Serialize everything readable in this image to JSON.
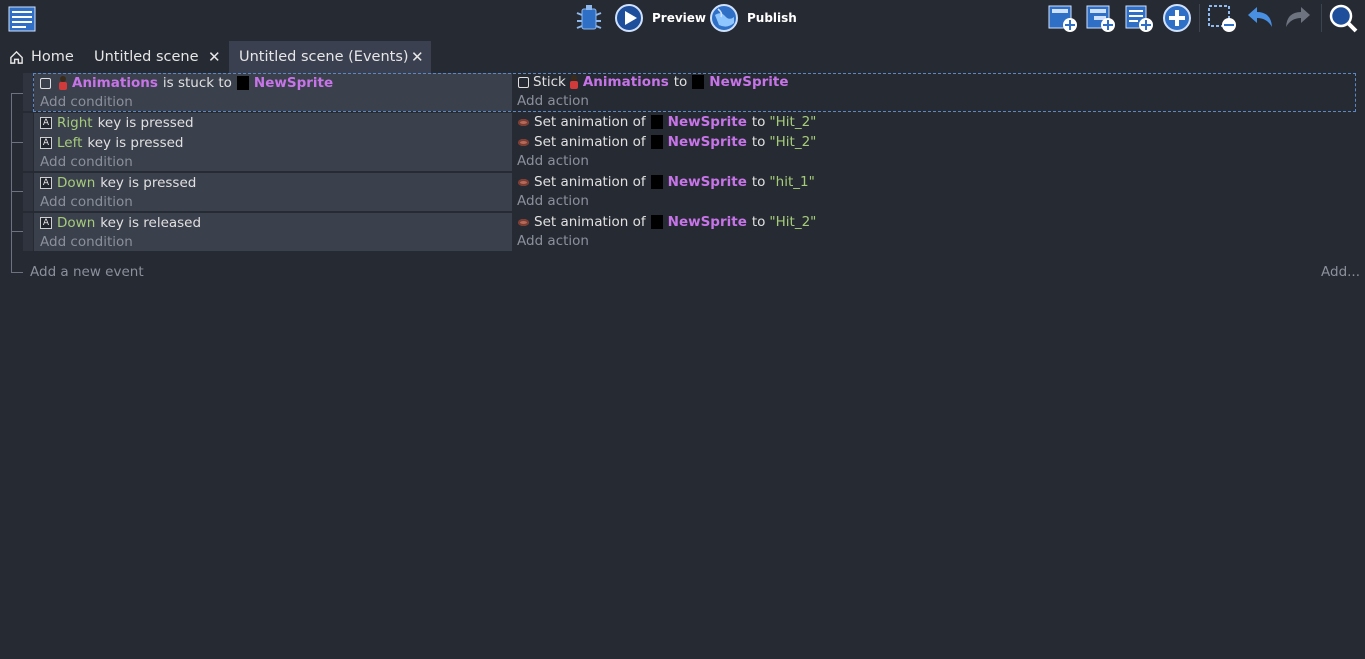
{
  "toolbar": {
    "preview_label": "Preview",
    "publish_label": "Publish",
    "icons": [
      "event-sheet-icon",
      "debugger-icon",
      "preview-icon",
      "publish-icon",
      "add-event-icon",
      "add-subevent-icon",
      "add-comment-icon",
      "add-other-icon",
      "delete-selection-icon",
      "undo-icon",
      "redo-icon",
      "search-icon"
    ]
  },
  "tabs": [
    {
      "label": "Home"
    },
    {
      "label": "Untitled scene"
    },
    {
      "label": "Untitled scene (Events)"
    }
  ],
  "events": [
    {
      "condition": {
        "object": "Animations",
        "text": "is stuck to",
        "target": "NewSprite"
      },
      "action": {
        "verb": "Stick",
        "object": "Animations",
        "mid": "to",
        "target": "NewSprite"
      }
    },
    {
      "conditions": [
        {
          "key": "Right",
          "text": "key is pressed"
        },
        {
          "key": "Left",
          "text": "key is pressed"
        }
      ],
      "actions": [
        {
          "text": "Set animation of",
          "object": "NewSprite",
          "mid": "to",
          "value": "\"Hit_2\""
        },
        {
          "text": "Set animation of",
          "object": "NewSprite",
          "mid": "to",
          "value": "\"Hit_2\""
        }
      ]
    },
    {
      "conditions": [
        {
          "key": "Down",
          "text": "key is pressed"
        }
      ],
      "actions": [
        {
          "text": "Set animation of",
          "object": "NewSprite",
          "mid": "to",
          "value": "\"hit_1\""
        }
      ]
    },
    {
      "conditions": [
        {
          "key": "Down",
          "text": "key is released"
        }
      ],
      "actions": [
        {
          "text": "Set animation of",
          "object": "NewSprite",
          "mid": "to",
          "value": "\"Hit_2\""
        }
      ]
    }
  ],
  "add_condition_label": "Add condition",
  "add_action_label": "Add action",
  "add_event_label": "Add a new event",
  "add_more_label": "Add...",
  "colors": {
    "background": "#262a33",
    "condition_bg": "#3b404d",
    "object_name": "#c774e8",
    "parameter": "#a6cc7a",
    "accent_blue": "#4a90e2"
  }
}
